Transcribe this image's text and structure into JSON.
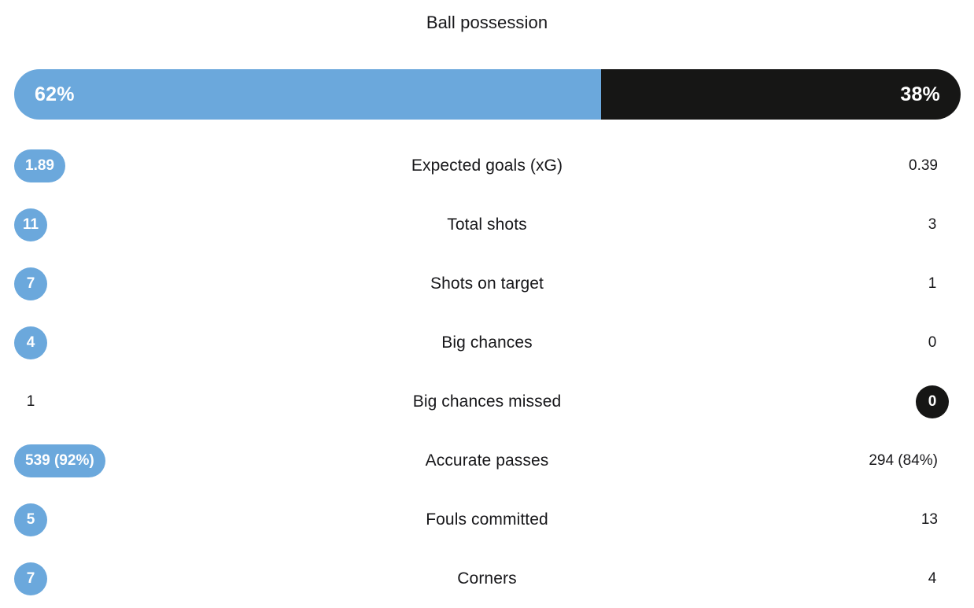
{
  "chart_data": {
    "type": "bar",
    "title": "Ball possession",
    "xlabel": "",
    "ylabel": "",
    "legend_position": "none",
    "grid": false,
    "series": [
      {
        "name": "home",
        "color": "#6ba8dc"
      },
      {
        "name": "away",
        "color": "#161615"
      }
    ],
    "possession": {
      "home_value": 62,
      "away_value": 38,
      "home_label": "62%",
      "away_label": "38%"
    },
    "categories": [
      "Expected goals (xG)",
      "Total shots",
      "Shots on target",
      "Big chances",
      "Big chances missed",
      "Accurate passes",
      "Fouls committed",
      "Corners"
    ],
    "home_values": [
      "1.89",
      "11",
      "7",
      "4",
      "1",
      "539 (92%)",
      "5",
      "7"
    ],
    "away_values": [
      "0.39",
      "3",
      "1",
      "0",
      "0",
      "294 (84%)",
      "13",
      "4"
    ]
  },
  "header": {
    "title": "Ball possession"
  },
  "possession_bar": {
    "home_pct_label": "62%",
    "away_pct_label": "38%",
    "home_pct": 62,
    "away_pct": 38,
    "home_color": "#6ba8dc",
    "away_color": "#161615"
  },
  "stats": [
    {
      "label": "Expected goals (xG)",
      "home": {
        "value": "1.89",
        "style": "blue-pill"
      },
      "away": {
        "value": "0.39",
        "style": "plain"
      }
    },
    {
      "label": "Total shots",
      "home": {
        "value": "11",
        "style": "blue-circle"
      },
      "away": {
        "value": "3",
        "style": "plain"
      }
    },
    {
      "label": "Shots on target",
      "home": {
        "value": "7",
        "style": "blue-circle"
      },
      "away": {
        "value": "1",
        "style": "plain"
      }
    },
    {
      "label": "Big chances",
      "home": {
        "value": "4",
        "style": "blue-circle"
      },
      "away": {
        "value": "0",
        "style": "plain"
      }
    },
    {
      "label": "Big chances missed",
      "home": {
        "value": "1",
        "style": "plain"
      },
      "away": {
        "value": "0",
        "style": "dark-circle"
      }
    },
    {
      "label": "Accurate passes",
      "home": {
        "value": "539 (92%)",
        "style": "blue-pill"
      },
      "away": {
        "value": "294 (84%)",
        "style": "plain"
      }
    },
    {
      "label": "Fouls committed",
      "home": {
        "value": "5",
        "style": "blue-circle"
      },
      "away": {
        "value": "13",
        "style": "plain"
      }
    },
    {
      "label": "Corners",
      "home": {
        "value": "7",
        "style": "blue-circle"
      },
      "away": {
        "value": "4",
        "style": "plain"
      }
    }
  ],
  "colors": {
    "home_accent": "#6ba8dc",
    "away_accent": "#161615",
    "text": "#17171a",
    "background": "#ffffff"
  }
}
